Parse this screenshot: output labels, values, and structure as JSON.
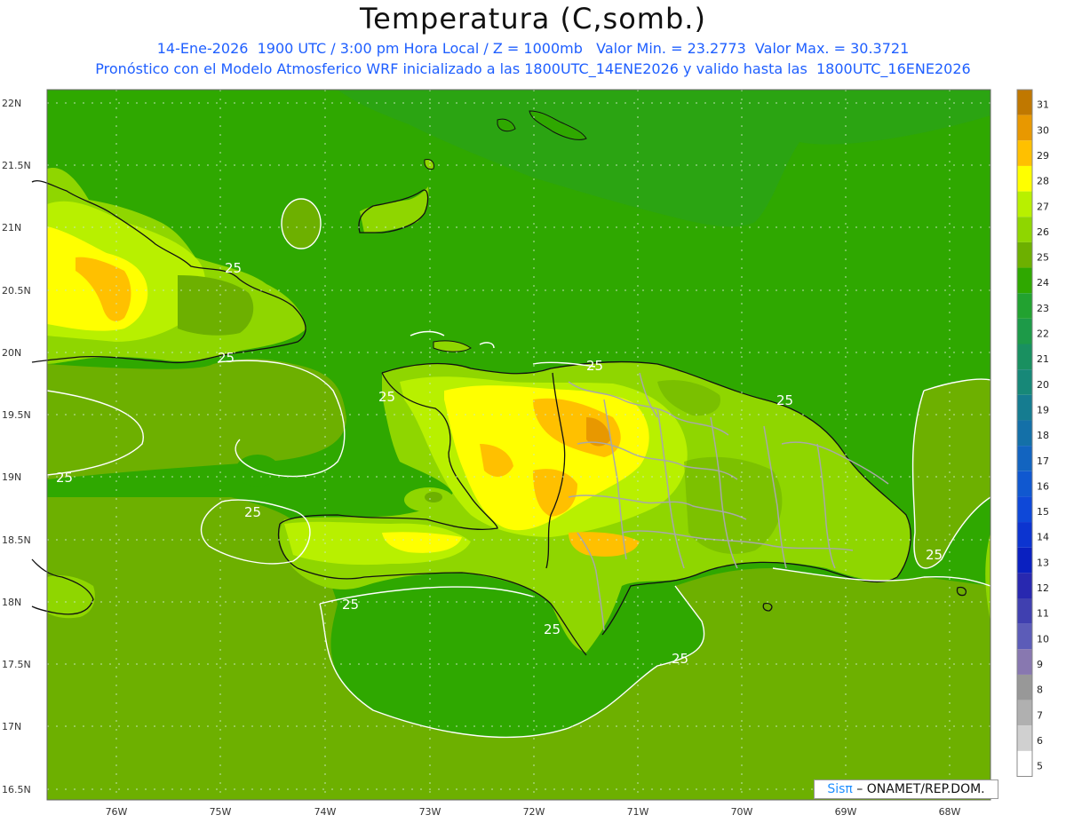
{
  "title": "Temperatura (C,somb.)",
  "subtitle1": "14-Ene-2026  1900 UTC / 3:00 pm Hora Local / Z = 1000mb   Valor Min. = 23.2773  Valor Max. = 30.3721",
  "subtitle2": "Pronóstico con el Modelo Atmosferico WRF inicializado a las 1800UTC_14ENE2026 y valido hasta las  1800UTC_16ENE2026",
  "lat_labels": [
    "22N",
    "21.5N",
    "21N",
    "20.5N",
    "20N",
    "19.5N",
    "19N",
    "18.5N",
    "18N",
    "17.5N",
    "17N",
    "16.5N"
  ],
  "lon_labels": [
    "76W",
    "75W",
    "74W",
    "73W",
    "72W",
    "71W",
    "70W",
    "69W",
    "68W"
  ],
  "contour_label": "25",
  "colorbar": {
    "labels": [
      "31",
      "30",
      "29",
      "28",
      "27",
      "26",
      "25",
      "24",
      "23",
      "22",
      "21",
      "20",
      "19",
      "18",
      "17",
      "16",
      "15",
      "14",
      "13",
      "12",
      "11",
      "10",
      "9",
      "8",
      "7",
      "6",
      "5"
    ],
    "colors": [
      "#c07800",
      "#e89800",
      "#ffc000",
      "#ffff00",
      "#b8f000",
      "#8fd600",
      "#6db000",
      "#2fa800",
      "#22a230",
      "#1d9a48",
      "#199060",
      "#178878",
      "#157c90",
      "#1470a8",
      "#1264c0",
      "#1058d0",
      "#0e48d8",
      "#0c34d0",
      "#0a20c0",
      "#2828b0",
      "#4040b0",
      "#5c5cb8",
      "#8878b0",
      "#989898",
      "#b0b0b0",
      "#d0d0d0",
      "#ffffff"
    ]
  },
  "field_colors": {
    "ocean": "#2fa800",
    "ocean_warm": "#6db000",
    "land_warm": "#8fd600",
    "land_warmer": "#b8f000",
    "land_hot": "#ffff00",
    "land_hottest": "#ffc000",
    "land_peak": "#e89800"
  },
  "credit": {
    "brand": "Sisπ",
    "text": " – ONAMET/REP.DOM."
  }
}
